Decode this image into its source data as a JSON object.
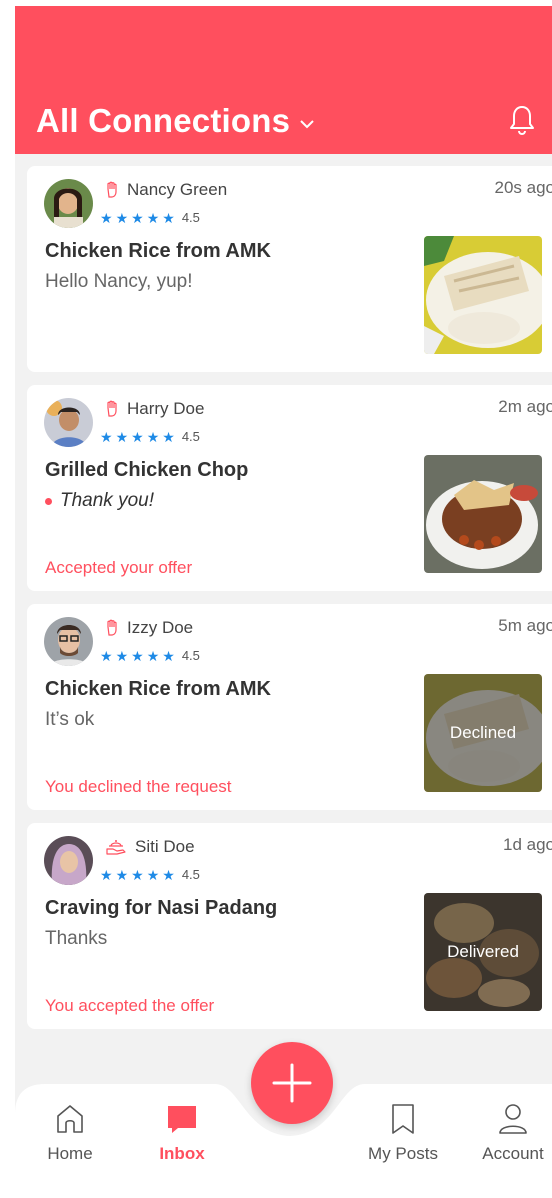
{
  "header": {
    "title": "All Connections"
  },
  "colors": {
    "accent": "#ff4f5e",
    "star": "#1e8ae6",
    "background": "#f2f2f2"
  },
  "cards": [
    {
      "name": "Nancy Green",
      "role_icon": "hand-icon",
      "rating": "4.5",
      "time": "20s ago",
      "title": "Chicken Rice from AMK",
      "message": "Hello Nancy, yup!",
      "status": "",
      "image_overlay": ""
    },
    {
      "name": "Harry Doe",
      "role_icon": "hand-icon",
      "rating": "4.5",
      "time": "2m ago",
      "title": "Grilled Chicken Chop",
      "message": "Thank you!",
      "status": "Accepted your offer",
      "image_overlay": ""
    },
    {
      "name": "Izzy Doe",
      "role_icon": "hand-icon",
      "rating": "4.5",
      "time": "5m ago",
      "title": "Chicken Rice from AMK",
      "message": "It’s ok",
      "status": "You declined the request",
      "image_overlay": "Declined"
    },
    {
      "name": "Siti Doe",
      "role_icon": "serving-hand-icon",
      "rating": "4.5",
      "time": "1d ago",
      "title": "Craving for Nasi Padang",
      "message": "Thanks",
      "status": "You accepted the offer",
      "image_overlay": "Delivered"
    }
  ],
  "nav": {
    "home": "Home",
    "inbox": "Inbox",
    "my_posts": "My Posts",
    "account": "Account"
  }
}
